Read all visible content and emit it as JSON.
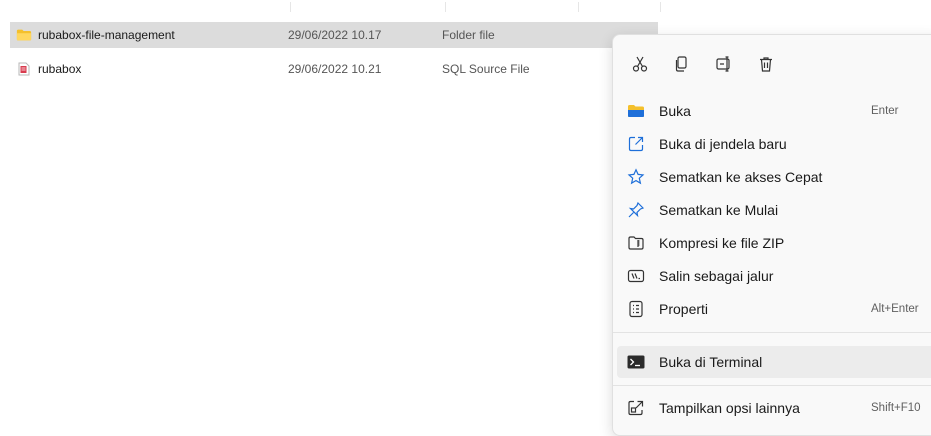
{
  "files": [
    {
      "name": "rubabox-file-management",
      "date": "29/06/2022 10.17",
      "type": "Folder file",
      "icon": "folder-icon",
      "selected": true
    },
    {
      "name": "rubabox",
      "date": "29/06/2022 10.21",
      "type": "SQL Source File",
      "icon": "sql-file-icon",
      "selected": false
    }
  ],
  "context_menu": {
    "toolbar": [
      {
        "icon": "cut-icon",
        "name": "cut"
      },
      {
        "icon": "copy-icon",
        "name": "copy"
      },
      {
        "icon": "rename-icon",
        "name": "rename"
      },
      {
        "icon": "delete-icon",
        "name": "delete"
      }
    ],
    "items": [
      {
        "label": "Buka",
        "shortcut": "Enter",
        "icon": "folder-open-icon"
      },
      {
        "label": "Buka di jendela baru",
        "shortcut": "",
        "icon": "open-new-window-icon"
      },
      {
        "label": "Sematkan ke akses Cepat",
        "shortcut": "",
        "icon": "star-icon"
      },
      {
        "label": "Sematkan ke Mulai",
        "shortcut": "",
        "icon": "pin-icon"
      },
      {
        "label": "Kompresi ke file ZIP",
        "shortcut": "",
        "icon": "zip-icon"
      },
      {
        "label": "Salin sebagai jalur",
        "shortcut": "",
        "icon": "path-icon"
      },
      {
        "label": "Properti",
        "shortcut": "Alt+Enter",
        "icon": "properties-icon"
      },
      {
        "label": "Buka di Terminal",
        "shortcut": "",
        "icon": "terminal-icon"
      },
      {
        "label": "Tampilkan opsi lainnya",
        "shortcut": "Shift+F10",
        "icon": "more-options-icon"
      }
    ]
  },
  "colors": {
    "folder": "#f4c02c",
    "accent": "#1e6fd9",
    "sql": "#d83b4e",
    "hover": "#ececec"
  }
}
